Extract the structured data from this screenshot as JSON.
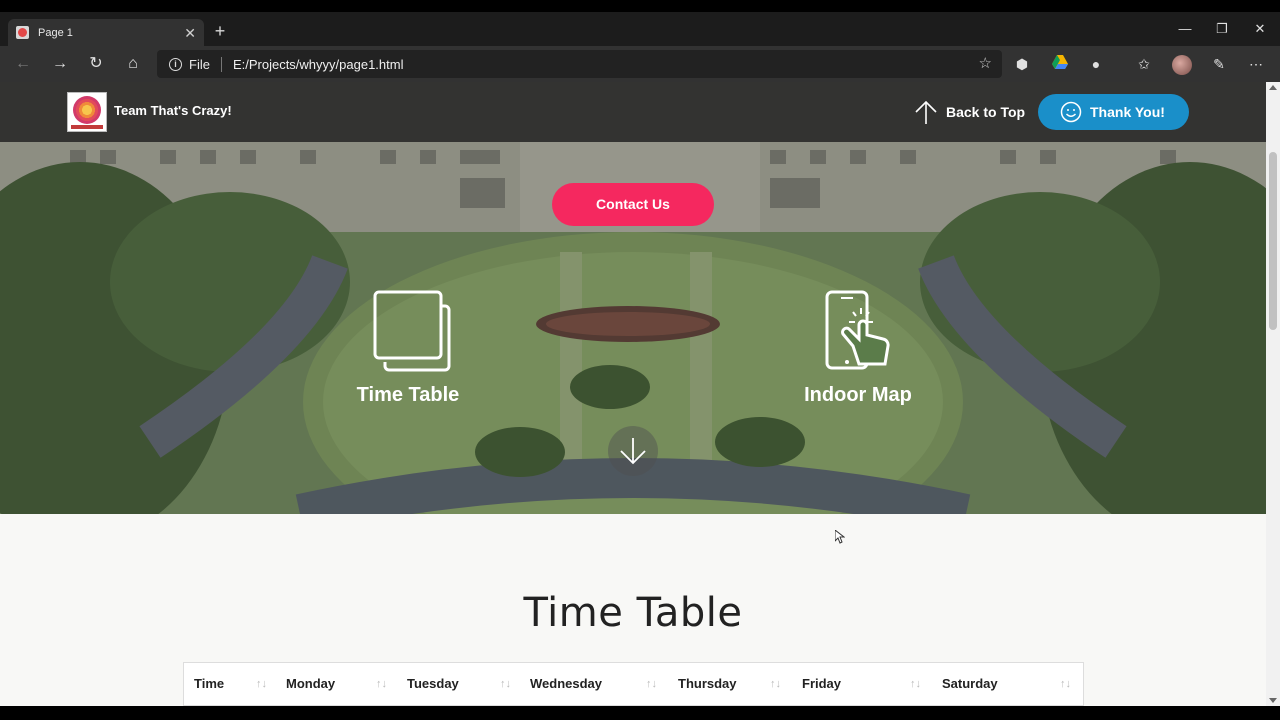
{
  "browser": {
    "tab_title": "Page 1",
    "address_scheme_label": "File",
    "url": "E:/Projects/whyyy/page1.html"
  },
  "site": {
    "brand": "Team That's Crazy!",
    "back_to_top": "Back to Top",
    "thank_you": "Thank You!",
    "contact_us": "Contact Us",
    "features": [
      {
        "label": "Time Table",
        "icon": "tablet-copy-icon"
      },
      {
        "label": "Indoor Map",
        "icon": "phone-touch-icon"
      }
    ],
    "section_title": "Time Table",
    "table_headers": [
      "Time",
      "Monday",
      "Tuesday",
      "Wednesday",
      "Thursday",
      "Friday",
      "Saturday"
    ]
  },
  "colors": {
    "header_bg": "#333331",
    "contact_pink": "#f5285f",
    "thank_blue": "#1a8fc9"
  }
}
